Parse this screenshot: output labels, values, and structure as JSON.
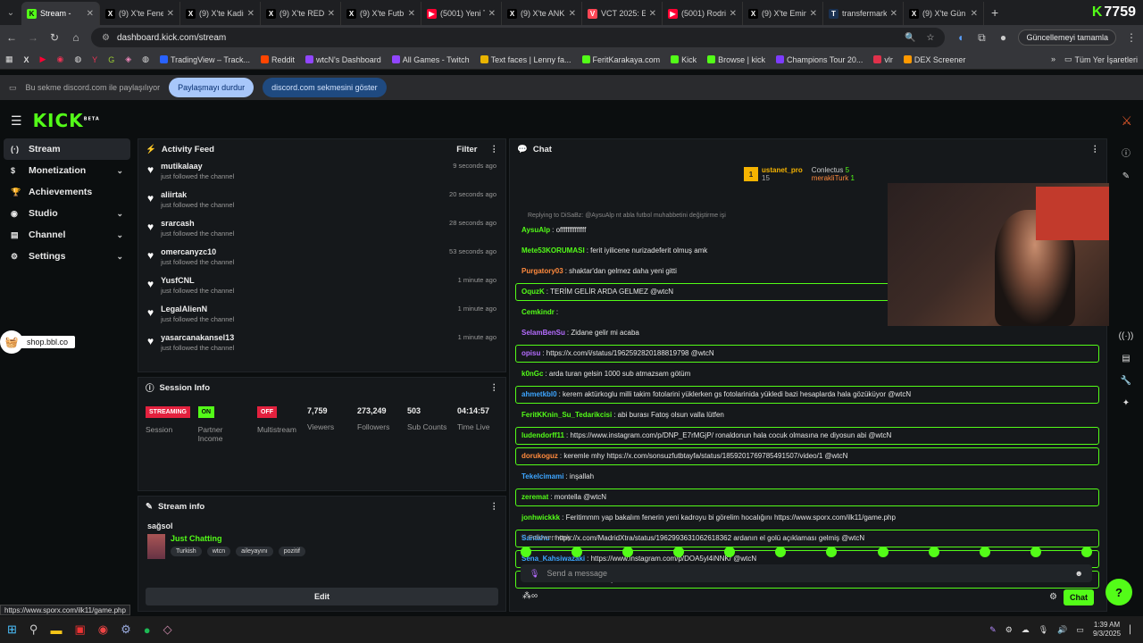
{
  "browser": {
    "tabs": [
      {
        "label": "Stream -",
        "fav": "K",
        "color": "#53fc18",
        "active": true
      },
      {
        "label": "(9) X'te Fene",
        "fav": "X",
        "color": "#000"
      },
      {
        "label": "(9) X'te Kadir",
        "fav": "X",
        "color": "#000"
      },
      {
        "label": "(9) X'te RED",
        "fav": "X",
        "color": "#000"
      },
      {
        "label": "(9) X'te Futb",
        "fav": "X",
        "color": "#000"
      },
      {
        "label": "(5001) Yeni T",
        "fav": "▶",
        "color": "#ff0033"
      },
      {
        "label": "(9) X'te ANK",
        "fav": "X",
        "color": "#000"
      },
      {
        "label": "VCT 2025: El",
        "fav": "V",
        "color": "#ff4655"
      },
      {
        "label": "(5001) Rodri",
        "fav": "▶",
        "color": "#ff0033"
      },
      {
        "label": "(9) X'te Emin",
        "fav": "X",
        "color": "#000"
      },
      {
        "label": "transfermark",
        "fav": "T",
        "color": "#1a3151"
      },
      {
        "label": "(9) X'te Gün",
        "fav": "X",
        "color": "#000"
      }
    ],
    "kick_count": "7759",
    "url": "dashboard.kick.com/stream",
    "update_label": "Güncellemeyi tamamla",
    "bookmarks": [
      "TradingView – Track...",
      "Reddit",
      "wtcN's Dashboard",
      "All Games - Twitch",
      "Text faces | Lenny fa...",
      "FeritKarakaya.com",
      "Kick",
      "Browse | kick",
      "Champions Tour 20...",
      "vlr",
      "DEX Screener"
    ],
    "bookmarks_all": "Tüm Yer İşaretleri",
    "share_text": "Bu sekme discord.com ile paylaşılıyor",
    "share_stop": "Paylaşmayı durdur",
    "share_show": "discord.com sekmesini göster"
  },
  "sidebar": {
    "items": [
      {
        "label": "Stream",
        "icon": "(·)",
        "chev": false
      },
      {
        "label": "Monetization",
        "icon": "$",
        "chev": true
      },
      {
        "label": "Achievements",
        "icon": "🏆",
        "chev": false
      },
      {
        "label": "Studio",
        "icon": "◉",
        "chev": true
      },
      {
        "label": "Channel",
        "icon": "▤",
        "chev": true
      },
      {
        "label": "Settings",
        "icon": "⚙",
        "chev": true
      }
    ],
    "shop": "shop.bbl.co"
  },
  "activity": {
    "title": "Activity Feed",
    "filter": "Filter",
    "sub": "just followed the channel",
    "rows": [
      {
        "name": "mutikalaay",
        "time": "9 seconds ago"
      },
      {
        "name": "aliirtak",
        "time": "20 seconds ago"
      },
      {
        "name": "srarcash",
        "time": "28 seconds ago"
      },
      {
        "name": "omercanyzc10",
        "time": "53 seconds ago"
      },
      {
        "name": "YusfCNL",
        "time": "1 minute ago"
      },
      {
        "name": "LegalAlienN",
        "time": "1 minute ago"
      },
      {
        "name": "yasarcanakansel13",
        "time": "1 minute ago"
      }
    ]
  },
  "session": {
    "title": "Session Info",
    "cells": [
      {
        "badge": "STREAMING",
        "kind": "red",
        "label": "Session"
      },
      {
        "badge": "ON",
        "kind": "green",
        "label": "Partner Income"
      },
      {
        "badge": "OFF",
        "kind": "red",
        "label": "Multistream"
      },
      {
        "value": "7,759",
        "label": "Viewers"
      },
      {
        "value": "273,249",
        "label": "Followers"
      },
      {
        "value": "503",
        "label": "Sub Counts"
      },
      {
        "value": "04:14:57",
        "label": "Time Live"
      }
    ]
  },
  "streaminfo": {
    "title": "Stream info",
    "stream_title": "sağsol",
    "category": "Just Chatting",
    "tags": [
      "Turkish",
      "wtcn",
      "aileyayını",
      "pozitif"
    ],
    "edit": "Edit"
  },
  "chat": {
    "title": "Chat",
    "top": {
      "name": "ustanet_pro",
      "count": "15",
      "u2": "Conlectus",
      "c2": "5",
      "u3": "merakliTurk",
      "c3": "1"
    },
    "reply": "Replying to DiSaBz: @AysuAlp nt abla futbol muhabbetini değiştirme işi",
    "lines": [
      {
        "u": "AysuAlp",
        "c": "#53fc18",
        "t": "offffffffffffff",
        "hl": false
      },
      {
        "u": "Mete53KORUMASI",
        "c": "#53fc18",
        "t": "ferit iyilicene nurizadeferit olmuş amk",
        "hl": false
      },
      {
        "u": "Purgatory03",
        "c": "#ff8a3d",
        "t": "shaktar'dan gelmez daha yeni gitti",
        "hl": false
      },
      {
        "u": "OquzK",
        "c": "#53fc18",
        "t": "TERİM GELİR ARDA GELMEZ @wtcN",
        "hl": true
      },
      {
        "u": "Cemkindr",
        "c": "#53fc18",
        "t": "",
        "hl": false
      },
      {
        "u": "SelamBenSu",
        "c": "#b56cff",
        "t": "Zidane gelir mi acaba",
        "hl": false
      },
      {
        "u": "opisu",
        "c": "#b56cff",
        "t": "https://x.com/i/status/1962592820188819798 @wtcN",
        "hl": true
      },
      {
        "u": "k0nGc",
        "c": "#53fc18",
        "t": "arda turan gelsin 1000 sub atmazsam götüm",
        "hl": false
      },
      {
        "u": "ahmetkbl0",
        "c": "#3da5ff",
        "t": "kerem aktürkoglu milli takim fotolarini yüklerken gs fotolarinida yükledi bazi hesaplarda hala gözüküyor @wtcN",
        "hl": true
      },
      {
        "u": "FeritKKnin_Su_Tedarikcisi",
        "c": "#53fc18",
        "t": "abi burası Fatoş olsun valla lütfen",
        "hl": false
      },
      {
        "u": "ludendorff11",
        "c": "#53fc18",
        "t": "https://www.instagram.com/p/DNP_E7rMGjP/ ronaldonun hala cocuk olmasına ne diyosun abi @wtcN",
        "hl": true
      },
      {
        "u": "dorukoguz",
        "c": "#ff8a3d",
        "t": "keremle mhy https://x.com/sonsuzfutbtayfa/status/1859201769785491507/video/1 @wtcN",
        "hl": true
      },
      {
        "u": "Tekelcimami",
        "c": "#3da5ff",
        "t": "inşallah",
        "hl": false
      },
      {
        "u": "zeremat",
        "c": "#53fc18",
        "t": "montella @wtcN",
        "hl": true
      },
      {
        "u": "jonhwickkk",
        "c": "#53fc18",
        "t": "Feritimmm yap bakalım fenerin yeni kadroyu bi görelim hocalığını https://www.sporx.com/ilk11/game.php",
        "hl": false
      },
      {
        "u": "Santahu",
        "c": "#3da5ff",
        "t": "https://x.com/MadridXtra/status/1962993631062618362 ardanın el golü açıklaması gelmiş @wtcN",
        "hl": true
      },
      {
        "u": "Sena_Kahsiwazaki",
        "c": "#3da5ff",
        "t": "https://www.instagram.com/p/DOA5yl4iNNK/ @wtcN",
        "hl": true
      },
      {
        "u": "Kufi_Kafada",
        "c": "#53fc18",
        "t": "abdullah avcıyı alın @wtcN",
        "hl": true
      }
    ],
    "followers_only": "Followers only",
    "placeholder": "Send a message",
    "send": "Chat"
  },
  "status_url": "https://www.sporx.com/ilk11/game.php",
  "taskbar": {
    "time": "1:39 AM",
    "date": "9/3/2025"
  }
}
